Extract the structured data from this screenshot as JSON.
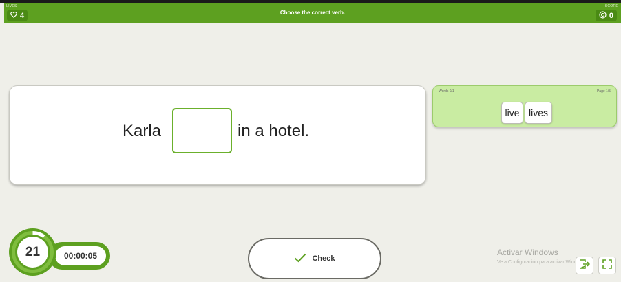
{
  "header": {
    "lives_caption": "LIVES",
    "lives_value": "4",
    "title": "Choose the correct verb.",
    "score_caption": "SCORE",
    "score_value": "0"
  },
  "sentence": {
    "before": "Karla",
    "after": "in a hotel."
  },
  "word_bank": {
    "words_counter": "Words 0/1",
    "page_counter": "Page 1/5",
    "options": [
      "live",
      "lives"
    ]
  },
  "timer": {
    "seconds_remaining": "21",
    "elapsed": "00:00:05",
    "remaining_fraction": 0.9
  },
  "check_button": {
    "label": "Check"
  },
  "watermark": {
    "title": "Activar Windows",
    "subtitle": "Ve a Configuración para activar Windows."
  },
  "icons": {
    "lives": "heart-icon",
    "score": "score-badge-icon",
    "check": "checkmark-icon",
    "exit": "exit-icon",
    "fullscreen": "fullscreen-icon"
  },
  "colors": {
    "accent_green": "#5da020",
    "word_bank_bg": "#c9eca2"
  }
}
